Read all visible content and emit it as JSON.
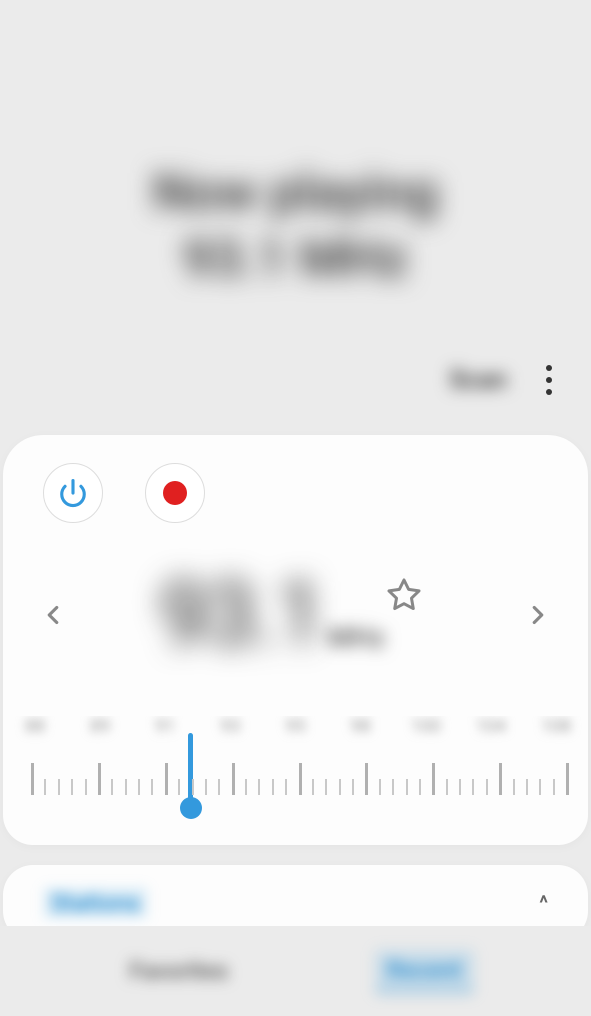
{
  "header": {
    "now_playing_label": "Now playing",
    "now_playing_freq": "93.1 MHz",
    "scan_label": "Scan"
  },
  "player": {
    "frequency": "93.1",
    "unit": "MHz",
    "dial_labels": [
      "88",
      "89",
      "91",
      "93",
      "95",
      "98",
      "100",
      "104",
      "108"
    ],
    "indicator_position_pct": 31.5
  },
  "stations": {
    "label": "Stations"
  },
  "tabs": {
    "favorites": "Favorites",
    "recent": "Recent"
  },
  "colors": {
    "accent": "#3399dd",
    "record": "#e02020"
  }
}
